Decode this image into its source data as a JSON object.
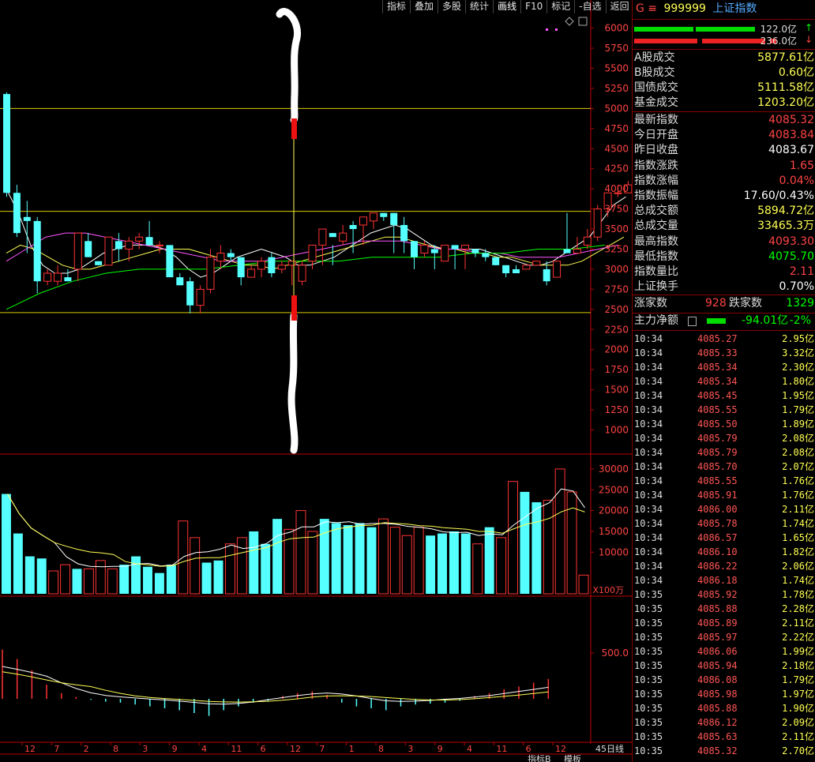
{
  "toolbar": {
    "items": [
      "指标",
      "叠加",
      "多股",
      "统计",
      "画线",
      "F10",
      "标记",
      "-自选",
      "返回"
    ]
  },
  "header": {
    "code_prefix": "G ≡",
    "code": "999999",
    "name": "上证指数"
  },
  "bars": {
    "up_value": "122.0亿",
    "up_arrow": "↑",
    "down_value": "236.0亿",
    "down_arrow": "↓"
  },
  "turnover": [
    {
      "label": "A股成交",
      "value": "5877.61亿"
    },
    {
      "label": "B股成交",
      "value": "0.60亿"
    },
    {
      "label": "国债成交",
      "value": "5111.58亿"
    },
    {
      "label": "基金成交",
      "value": "1203.20亿"
    }
  ],
  "quote": [
    {
      "label": "最新指数",
      "value": "4085.32",
      "color": "#ff4444"
    },
    {
      "label": "今日开盘",
      "value": "4083.84",
      "color": "#ff4444"
    },
    {
      "label": "昨日收盘",
      "value": "4083.67",
      "color": "#ffffff"
    },
    {
      "label": "指数涨跌",
      "value": "1.65",
      "color": "#ff4444"
    },
    {
      "label": "指数涨幅",
      "value": "0.04%",
      "color": "#ff4444"
    },
    {
      "label": "指数振幅",
      "value": "17.60/0.43%",
      "color": "#ffffff"
    },
    {
      "label": "总成交额",
      "value": "5894.72亿",
      "color": "#ffff55"
    },
    {
      "label": "总成交量",
      "value": "33465.3万",
      "color": "#ffff55"
    },
    {
      "label": "最高指数",
      "value": "4093.30",
      "color": "#ff4444"
    },
    {
      "label": "最低指数",
      "value": "4075.70",
      "color": "#00ff00"
    },
    {
      "label": "指数量比",
      "value": "2.11",
      "color": "#ff4444"
    },
    {
      "label": "上证换手",
      "value": "0.70%",
      "color": "#ffffff"
    }
  ],
  "breadth": {
    "up_label": "涨家数",
    "up_value": "928",
    "down_label": "跌家数",
    "down_value": "1329"
  },
  "mainflow": {
    "label": "主力净额",
    "value": "-94.01亿",
    "pct": "-2%"
  },
  "ticks": [
    {
      "t": "10:34",
      "p": "4085.27",
      "v": "2.95亿"
    },
    {
      "t": "10:34",
      "p": "4085.33",
      "v": "3.32亿"
    },
    {
      "t": "10:34",
      "p": "4085.34",
      "v": "2.30亿"
    },
    {
      "t": "10:34",
      "p": "4085.34",
      "v": "1.80亿"
    },
    {
      "t": "10:34",
      "p": "4085.45",
      "v": "1.95亿"
    },
    {
      "t": "10:34",
      "p": "4085.55",
      "v": "1.79亿"
    },
    {
      "t": "10:34",
      "p": "4085.50",
      "v": "1.89亿"
    },
    {
      "t": "10:34",
      "p": "4085.79",
      "v": "2.08亿"
    },
    {
      "t": "10:34",
      "p": "4085.79",
      "v": "2.08亿"
    },
    {
      "t": "10:34",
      "p": "4085.70",
      "v": "2.07亿"
    },
    {
      "t": "10:34",
      "p": "4085.55",
      "v": "1.76亿"
    },
    {
      "t": "10:34",
      "p": "4085.91",
      "v": "1.76亿"
    },
    {
      "t": "10:34",
      "p": "4086.00",
      "v": "2.11亿"
    },
    {
      "t": "10:34",
      "p": "4085.78",
      "v": "1.74亿"
    },
    {
      "t": "10:34",
      "p": "4086.57",
      "v": "1.65亿"
    },
    {
      "t": "10:34",
      "p": "4086.10",
      "v": "1.82亿"
    },
    {
      "t": "10:34",
      "p": "4086.22",
      "v": "2.06亿"
    },
    {
      "t": "10:34",
      "p": "4086.18",
      "v": "1.74亿"
    },
    {
      "t": "10:35",
      "p": "4085.92",
      "v": "1.78亿"
    },
    {
      "t": "10:35",
      "p": "4085.88",
      "v": "2.28亿"
    },
    {
      "t": "10:35",
      "p": "4085.89",
      "v": "2.11亿"
    },
    {
      "t": "10:35",
      "p": "4085.97",
      "v": "2.22亿"
    },
    {
      "t": "10:35",
      "p": "4086.06",
      "v": "1.99亿"
    },
    {
      "t": "10:35",
      "p": "4085.94",
      "v": "2.18亿"
    },
    {
      "t": "10:35",
      "p": "4086.08",
      "v": "1.79亿"
    },
    {
      "t": "10:35",
      "p": "4085.98",
      "v": "1.97亿"
    },
    {
      "t": "10:35",
      "p": "4085.88",
      "v": "1.90亿"
    },
    {
      "t": "10:35",
      "p": "4086.12",
      "v": "2.09亿"
    },
    {
      "t": "10:35",
      "p": "4085.63",
      "v": "2.11亿"
    },
    {
      "t": "10:35",
      "p": "4085.32",
      "v": "2.70亿"
    }
  ],
  "chart_data": {
    "type": "candlestick",
    "price_axis": {
      "ylim": [
        700,
        6350
      ],
      "ticks": [
        "6000",
        "5750",
        "5500",
        "5250",
        "5000",
        "4750",
        "4500",
        "4250",
        "4000",
        "3750",
        "3500",
        "3250",
        "3000",
        "2750",
        "2500",
        "2250",
        "2000",
        "1750",
        "1500",
        "1250",
        "1000"
      ]
    },
    "volume_axis": {
      "ylim": [
        0,
        31500
      ],
      "ticks": [
        "30000",
        "25000",
        "20000",
        "15000",
        "10000"
      ],
      "unit": "X100万"
    },
    "macd_axis": {
      "ticks": [
        "500.0"
      ]
    },
    "x_labels": [
      "12",
      "7",
      "2",
      "8",
      "3",
      "9",
      "4",
      "11",
      "6",
      "12",
      "7",
      "1",
      "8",
      "3",
      "9",
      "4",
      "11",
      "6",
      "12"
    ],
    "period_label": "45日线",
    "bottom_tabs": [
      "指标B",
      "模板"
    ],
    "hlines": [
      5000,
      3720,
      2460
    ],
    "candles": [
      [
        5180,
        3950,
        5200,
        3900
      ],
      [
        3950,
        3450,
        4050,
        3400
      ],
      [
        3650,
        3600,
        3850,
        3200
      ],
      [
        3600,
        2850,
        3650,
        2700
      ],
      [
        2850,
        2950,
        3000,
        2800
      ],
      [
        2850,
        2950,
        3050,
        2800
      ],
      [
        2900,
        2850,
        3000,
        2850
      ],
      [
        3000,
        3450,
        3150,
        2850
      ],
      [
        3350,
        3150,
        3450,
        3150
      ],
      [
        3100,
        3050,
        3100,
        3050
      ],
      [
        3050,
        3400,
        3350,
        3050
      ],
      [
        3350,
        3250,
        3450,
        3100
      ],
      [
        3250,
        3350,
        3400,
        3100
      ],
      [
        3350,
        3400,
        3450,
        3250
      ],
      [
        3400,
        3300,
        3600,
        3300
      ],
      [
        3300,
        3300,
        3350,
        3200
      ],
      [
        3300,
        2900,
        3300,
        2900
      ],
      [
        2900,
        2800,
        2950,
        2800
      ],
      [
        2850,
        2550,
        2900,
        2450
      ],
      [
        2550,
        2750,
        2800,
        2450
      ],
      [
        2750,
        3150,
        3250,
        2700
      ],
      [
        3100,
        3200,
        3300,
        3000
      ],
      [
        3200,
        3150,
        3250,
        3100
      ],
      [
        3150,
        2900,
        3150,
        2800
      ],
      [
        2900,
        3000,
        3050,
        2900
      ],
      [
        3000,
        3100,
        3150,
        2900
      ],
      [
        3150,
        2950,
        3200,
        2900
      ],
      [
        3000,
        3050,
        3100,
        2950
      ],
      [
        3050,
        3100,
        3050,
        2800
      ],
      [
        2850,
        3050,
        3100,
        2800
      ],
      [
        3100,
        3300,
        3150,
        3000
      ],
      [
        3300,
        3500,
        3450,
        3050
      ],
      [
        3450,
        3400,
        3300,
        3050
      ],
      [
        3350,
        3450,
        3550,
        3300
      ],
      [
        3550,
        3500,
        3600,
        3200
      ],
      [
        3550,
        3650,
        3650,
        3300
      ],
      [
        3600,
        3700,
        3700,
        3500
      ],
      [
        3700,
        3650,
        3700,
        3600
      ],
      [
        3700,
        3550,
        3700,
        3200
      ],
      [
        3550,
        3350,
        3650,
        3200
      ],
      [
        3350,
        3150,
        3350,
        3000
      ],
      [
        3200,
        3300,
        3350,
        3150
      ],
      [
        3250,
        3200,
        3300,
        3000
      ],
      [
        3100,
        3300,
        3100,
        3100
      ],
      [
        3300,
        3250,
        3300,
        3000
      ],
      [
        3250,
        3300,
        3250,
        3000
      ],
      [
        3250,
        3200,
        3250,
        3150
      ],
      [
        3200,
        3150,
        3250,
        3100
      ],
      [
        3150,
        3050,
        3100,
        3050
      ],
      [
        3050,
        2950,
        3050,
        2900
      ],
      [
        3000,
        2950,
        3050,
        2950
      ],
      [
        3000,
        3050,
        3050,
        3000
      ],
      [
        3050,
        3100,
        3100,
        3050
      ],
      [
        3000,
        2850,
        3100,
        2800
      ],
      [
        2900,
        3100,
        3000,
        3000
      ],
      [
        3250,
        3200,
        3700,
        3200
      ],
      [
        3200,
        3250,
        3400,
        3200
      ],
      [
        3300,
        3400,
        3500,
        3250
      ],
      [
        3400,
        3750,
        3800,
        3350
      ],
      [
        3750,
        3950,
        3950,
        3650
      ],
      [
        3950,
        3950,
        4050,
        3900
      ],
      [
        3950,
        4050,
        4100,
        3950
      ]
    ],
    "ma_lines": [
      {
        "color": "#ffffff",
        "values": [
          4000,
          3700,
          3300,
          3050,
          2950,
          2950,
          3000,
          3100,
          3200,
          3250,
          3300,
          3300,
          3300,
          3250,
          3150,
          3000,
          2900,
          2950,
          3050,
          3150,
          3200,
          3250,
          3200,
          3150,
          3050,
          3050,
          3100,
          3150,
          3250,
          3350,
          3450,
          3500,
          3550,
          3500,
          3400,
          3300,
          3250,
          3250,
          3250,
          3250,
          3200,
          3150,
          3100,
          3050,
          3050,
          3100,
          3200,
          3300,
          3400,
          3600,
          3800,
          3900
        ]
      },
      {
        "color": "#ffff55",
        "values": [
          3200,
          3300,
          3250,
          3150,
          3050,
          3000,
          3000,
          3050,
          3100,
          3150,
          3200,
          3250,
          3250,
          3250,
          3200,
          3150,
          3100,
          3050,
          3050,
          3000,
          3050,
          3100,
          3150,
          3200,
          3250,
          3300,
          3350,
          3400,
          3400,
          3350,
          3300,
          3250,
          3250,
          3200,
          3200,
          3150,
          3150,
          3100,
          3050,
          3050,
          3050,
          3100,
          3200,
          3300,
          3400
        ]
      },
      {
        "color": "#ff55ff",
        "values": [
          3100,
          3250,
          3400,
          3450,
          3450,
          3400,
          3350,
          3300,
          3250,
          3200,
          3150,
          3100,
          3100,
          3100,
          3150,
          3200,
          3250,
          3300,
          3350,
          3350,
          3350,
          3300,
          3250,
          3250,
          3200,
          3200,
          3150,
          3150,
          3150,
          3200,
          3250,
          3300
        ]
      },
      {
        "color": "#00ff00",
        "values": [
          2500,
          2700,
          2850,
          2950,
          3000,
          3000,
          3000,
          3050,
          3100,
          3100,
          3100,
          3150,
          3150,
          3150,
          3200,
          3200,
          3250,
          3250,
          3300
        ]
      }
    ],
    "volumes": [
      [
        24000,
        "c"
      ],
      [
        14500,
        "c"
      ],
      [
        9000,
        "c"
      ],
      [
        8500,
        "c"
      ],
      [
        5500,
        "r"
      ],
      [
        7000,
        "r"
      ],
      [
        6000,
        "c"
      ],
      [
        6000,
        "r"
      ],
      [
        8000,
        "r"
      ],
      [
        6000,
        "r"
      ],
      [
        7000,
        "c"
      ],
      [
        9000,
        "c"
      ],
      [
        6500,
        "c"
      ],
      [
        5000,
        "c"
      ],
      [
        7000,
        "c"
      ],
      [
        17500,
        "r"
      ],
      [
        13500,
        "r"
      ],
      [
        7500,
        "c"
      ],
      [
        8000,
        "c"
      ],
      [
        12000,
        "r"
      ],
      [
        13500,
        "r"
      ],
      [
        15000,
        "c"
      ],
      [
        12000,
        "c"
      ],
      [
        18000,
        "c"
      ],
      [
        15500,
        "r"
      ],
      [
        20000,
        "r"
      ],
      [
        15000,
        "r"
      ],
      [
        18000,
        "c"
      ],
      [
        17000,
        "c"
      ],
      [
        16500,
        "c"
      ],
      [
        17000,
        "c"
      ],
      [
        16000,
        "c"
      ],
      [
        18000,
        "r"
      ],
      [
        16000,
        "r"
      ],
      [
        14000,
        "r"
      ],
      [
        16000,
        "r"
      ],
      [
        14000,
        "c"
      ],
      [
        14500,
        "c"
      ],
      [
        15000,
        "c"
      ],
      [
        14500,
        "c"
      ],
      [
        12000,
        "r"
      ],
      [
        16000,
        "c"
      ],
      [
        13500,
        "r"
      ],
      [
        27000,
        "r"
      ],
      [
        24500,
        "c"
      ],
      [
        22000,
        "c"
      ],
      [
        22500,
        "r"
      ],
      [
        30000,
        "r"
      ],
      [
        24500,
        "r"
      ],
      [
        4500,
        "r"
      ]
    ],
    "macd": [
      [
        520,
        "r"
      ],
      [
        420,
        "r"
      ],
      [
        300,
        "r"
      ],
      [
        150,
        "r"
      ],
      [
        60,
        "r"
      ],
      [
        20,
        "r"
      ],
      [
        -10,
        "c"
      ],
      [
        -30,
        "c"
      ],
      [
        -40,
        "c"
      ],
      [
        -60,
        "c"
      ],
      [
        -80,
        "c"
      ],
      [
        -100,
        "c"
      ],
      [
        -120,
        "c"
      ],
      [
        -150,
        "c"
      ],
      [
        -180,
        "c"
      ],
      [
        -120,
        "c"
      ],
      [
        -80,
        "c"
      ],
      [
        -40,
        "c"
      ],
      [
        -20,
        "c"
      ],
      [
        30,
        "r"
      ],
      [
        60,
        "r"
      ],
      [
        80,
        "r"
      ],
      [
        40,
        "r"
      ],
      [
        -40,
        "c"
      ],
      [
        -80,
        "c"
      ],
      [
        -100,
        "c"
      ],
      [
        -120,
        "c"
      ],
      [
        -80,
        "c"
      ],
      [
        -60,
        "c"
      ],
      [
        -50,
        "c"
      ],
      [
        -40,
        "c"
      ],
      [
        -20,
        "c"
      ],
      [
        30,
        "r"
      ],
      [
        60,
        "r"
      ],
      [
        100,
        "r"
      ],
      [
        130,
        "r"
      ],
      [
        170,
        "r"
      ],
      [
        210,
        "r"
      ]
    ]
  }
}
